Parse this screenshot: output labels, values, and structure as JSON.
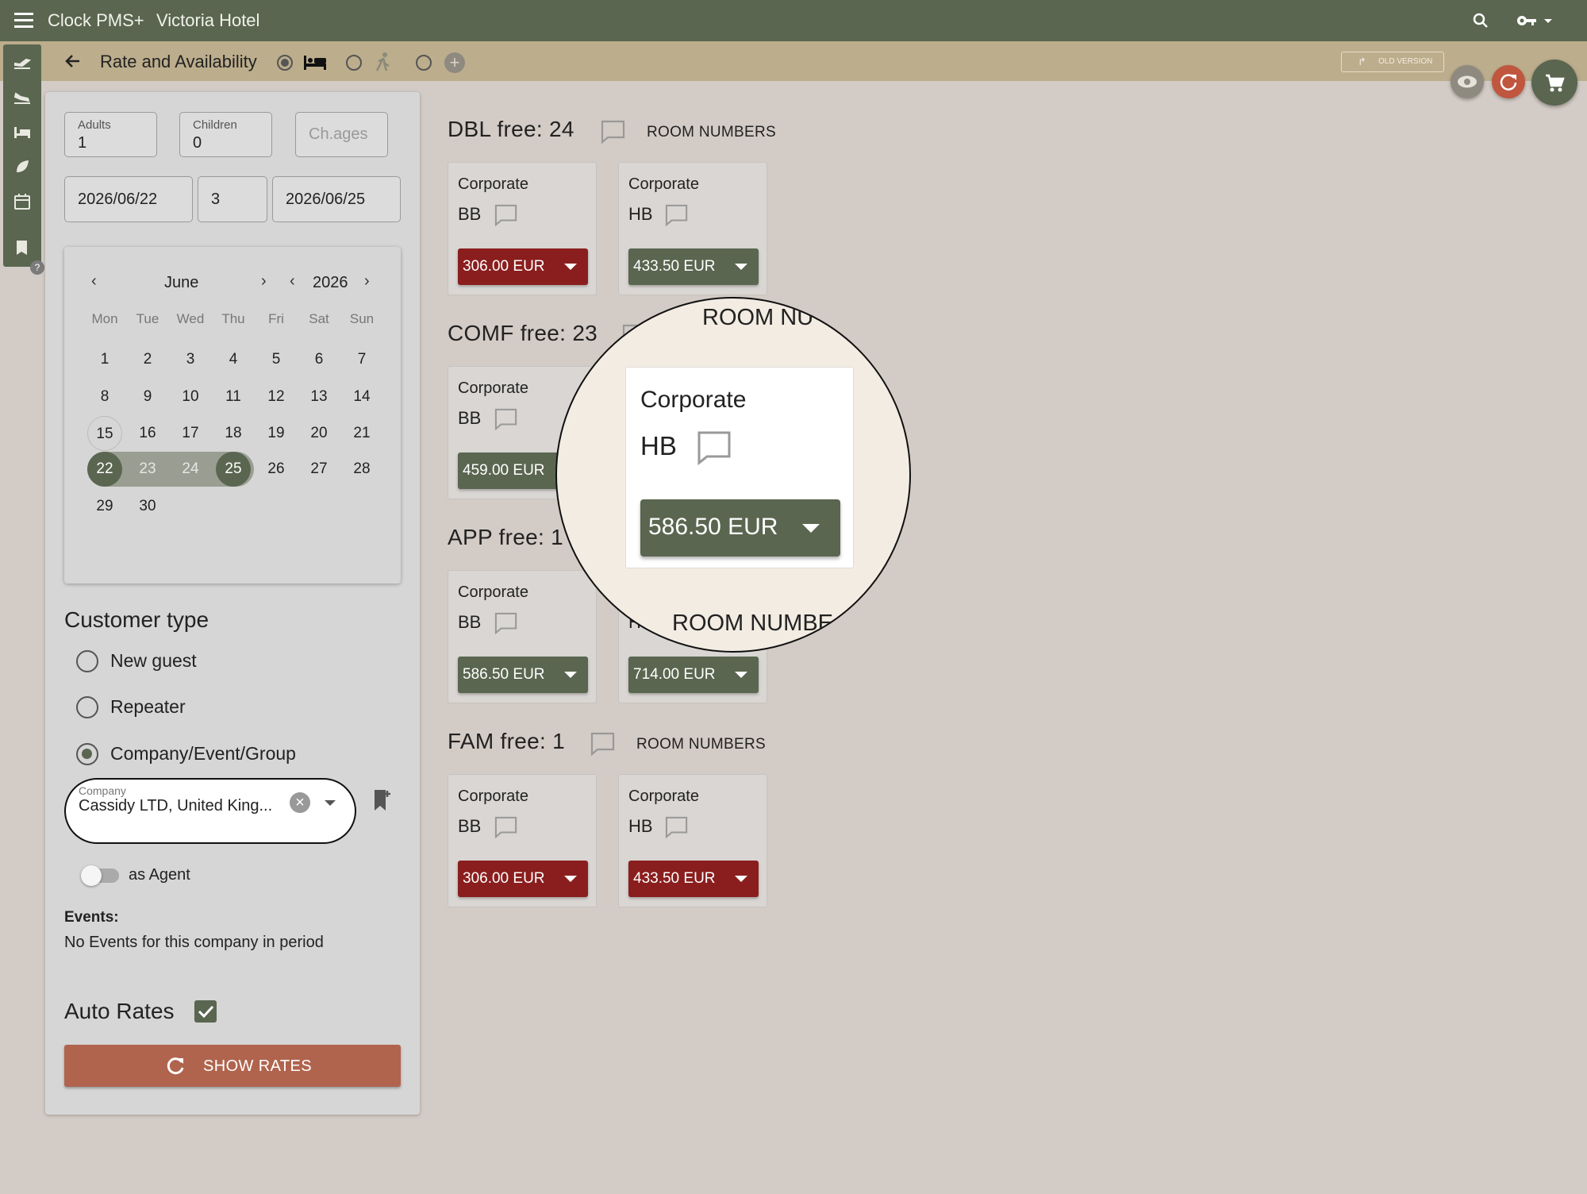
{
  "app": {
    "title": "Clock PMS+",
    "hotel": "Victoria Hotel"
  },
  "subbar": {
    "title": "Rate and Availability",
    "old_version": "OLD VERSION"
  },
  "icons": {
    "menu": "menu-icon",
    "search": "search-icon",
    "key": "key-icon",
    "back": "back-arrow-icon",
    "bed": "bed-icon",
    "walk": "walk-icon",
    "plus": "plus-circle-icon",
    "eye": "eye-icon",
    "refresh": "refresh-icon",
    "cart": "cart-icon",
    "comment": "comment-icon"
  },
  "colors": {
    "primary": "#5a6650",
    "accent_red": "#8a1e1e",
    "show_rates": "#b0644e",
    "refresh_btn": "#c0563e"
  },
  "guests": {
    "adults_label": "Adults",
    "adults": "1",
    "children_label": "Children",
    "children": "0",
    "ages_placeholder": "Ch.ages"
  },
  "dates": {
    "arrival": "2026/06/22",
    "nights": "3",
    "departure": "2026/06/25"
  },
  "calendar": {
    "month": "June",
    "year": "2026",
    "weekdays": [
      "Mon",
      "Tue",
      "Wed",
      "Thu",
      "Fri",
      "Sat",
      "Sun"
    ],
    "weeks": [
      [
        "1",
        "2",
        "3",
        "4",
        "5",
        "6",
        "7"
      ],
      [
        "8",
        "9",
        "10",
        "11",
        "12",
        "13",
        "14"
      ],
      [
        "15",
        "16",
        "17",
        "18",
        "19",
        "20",
        "21"
      ],
      [
        "22",
        "23",
        "24",
        "25",
        "26",
        "27",
        "28"
      ],
      [
        "29",
        "30",
        "",
        "",
        "",
        "",
        ""
      ]
    ],
    "range_start": "22",
    "range_end": "25",
    "today": "15"
  },
  "customer": {
    "title": "Customer type",
    "options": [
      "New guest",
      "Repeater",
      "Company/Event/Group"
    ],
    "selected": "Company/Event/Group",
    "company_label": "Company",
    "company_value": "Cassidy LTD, United King...",
    "agent_label": "as Agent",
    "events_title": "Events:",
    "events_text": "No Events for this company in period"
  },
  "auto_rates": {
    "label": "Auto Rates",
    "checked": true
  },
  "show_rates": "SHOW RATES",
  "room_numbers": "ROOM NUMBERS",
  "room_types": [
    {
      "title": "DBL free: 24",
      "rates": [
        {
          "name": "Corporate",
          "plan": "BB",
          "price": "306.00 EUR",
          "status": "red"
        },
        {
          "name": "Corporate",
          "plan": "HB",
          "price": "433.50 EUR",
          "status": "green"
        }
      ]
    },
    {
      "title": "COMF free: 23",
      "rates": [
        {
          "name": "Corporate",
          "plan": "BB",
          "price": "459.00 EUR",
          "status": "green"
        },
        {
          "name": "Corporate",
          "plan": "HB",
          "price": "586.50 EUR",
          "status": "green"
        }
      ]
    },
    {
      "title": "APP free: 1",
      "rates": [
        {
          "name": "Corporate",
          "plan": "BB",
          "price": "586.50 EUR",
          "status": "green"
        },
        {
          "name": "Corporate",
          "plan": "HB",
          "price": "714.00 EUR",
          "status": "green"
        }
      ]
    },
    {
      "title": "FAM free: 1",
      "rates": [
        {
          "name": "Corporate",
          "plan": "BB",
          "price": "306.00 EUR",
          "status": "red"
        },
        {
          "name": "Corporate",
          "plan": "HB",
          "price": "433.50 EUR",
          "status": "red"
        }
      ]
    }
  ],
  "magnifier": {
    "top_text": "ROOM NU",
    "name": "Corporate",
    "plan": "HB",
    "price": "586.50 EUR",
    "bottom_text": "ROOM NUMBE"
  }
}
